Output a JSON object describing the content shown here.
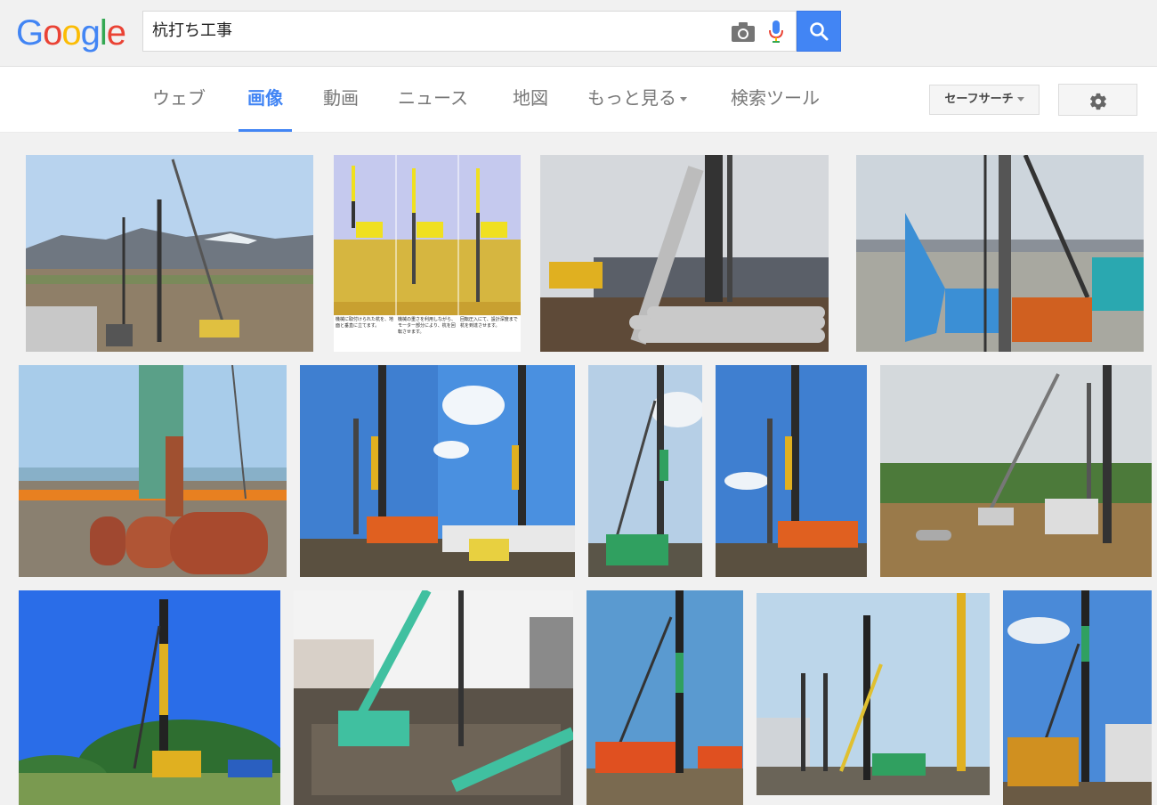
{
  "logo": {
    "letters": [
      "G",
      "o",
      "o",
      "g",
      "l",
      "e"
    ]
  },
  "search": {
    "query": "杭打ち工事"
  },
  "icons": {
    "camera": "camera-icon",
    "mic": "microphone-icon",
    "search": "magnifier-icon",
    "gear": "gear-icon"
  },
  "colors": {
    "accent": "#4285f4",
    "google_blue": "#4285f4",
    "google_red": "#ea4335",
    "google_yellow": "#fbbc05",
    "google_green": "#34a853"
  },
  "nav": {
    "tabs": [
      {
        "label": "ウェブ"
      },
      {
        "label": "画像",
        "active": true
      },
      {
        "label": "動画"
      },
      {
        "label": "ニュース"
      },
      {
        "label": "地図"
      },
      {
        "label": "もっと見る",
        "dropdown": true
      },
      {
        "label": "検索ツール"
      }
    ],
    "safesearch_label": "セーフサーチ"
  },
  "results": {
    "diagram_captions": [
      "機械に取付けられた杭を、地面と垂直に立てます。",
      "機械の重さを利用しながら、モーター部分により、杭を回転させます。",
      "回転圧入にて、設計深度まで杭を到達させます。"
    ]
  }
}
